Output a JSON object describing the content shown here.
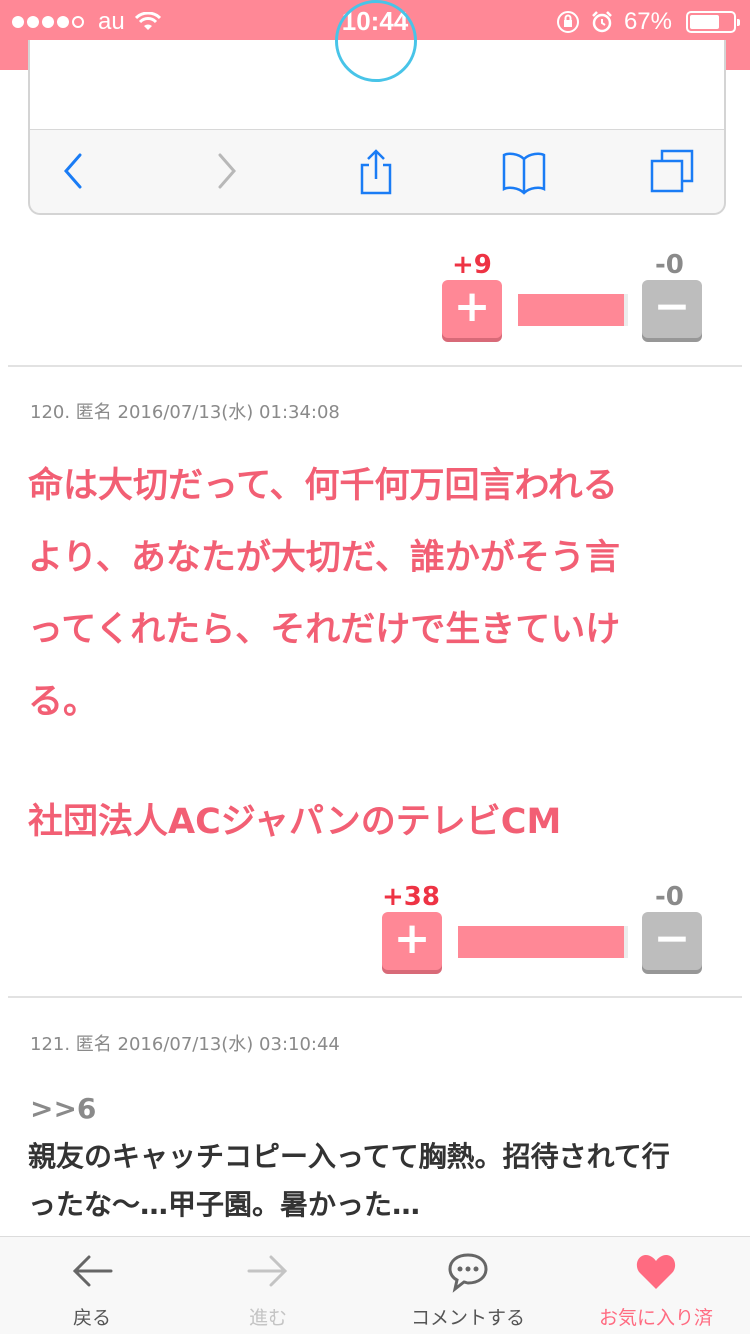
{
  "status_bar": {
    "carrier": "au",
    "time": "10:44",
    "battery": "67%",
    "battery_level": 0.67
  },
  "comments": [
    {
      "plus_count": "+9",
      "minus_count": "-0",
      "plus_symbol": "+",
      "minus_symbol": "−"
    },
    {
      "meta": "120. 匿名 2016/07/13(水) 01:34:08",
      "body_lines": [
        "命は大切だって、何千何万回言われる",
        "より、あなたが大切だ、誰かがそう言",
        "ってくれたら、それだけで生きていけ",
        "る。"
      ],
      "footer": "社団法人ACジャパンのテレビCM",
      "plus_count": "+38",
      "minus_count": "-0",
      "plus_symbol": "+",
      "minus_symbol": "−"
    },
    {
      "meta": "121. 匿名 2016/07/13(水) 03:10:44",
      "anchor": ">>6",
      "body_lines": [
        "親友のキャッチコピー入ってて胸熱。招待されて行",
        "ったな〜…甲子園。暑かった…"
      ]
    }
  ],
  "bottom_nav": {
    "back_label": "戻る",
    "forward_label": "進む",
    "comment_label": "コメントする",
    "favorite_label": "お気に入り済"
  },
  "colors": {
    "accent": "#ff8896",
    "pink_text": "#f25f74",
    "plus_red": "#ee3344",
    "gray": "#8a8a8a",
    "safari_blue": "#1a7cf5"
  }
}
